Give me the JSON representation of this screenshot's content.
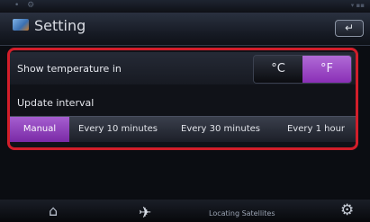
{
  "window": {
    "title": "Setting",
    "back_label": "↵"
  },
  "temperature": {
    "label": "Show temperature in",
    "options": [
      "°C",
      "°F"
    ],
    "selected": "°F"
  },
  "update_interval": {
    "label": "Update interval",
    "options": [
      "Manual",
      "Every 10 minutes",
      "Every 30 minutes",
      "Every 1 hour"
    ],
    "selected": "Manual"
  },
  "status": {
    "satellite_text": "Locating Satellites"
  },
  "icons": {
    "home": "home-icon",
    "satellite": "satellite-icon",
    "settings": "gear-icon",
    "back": "back-arrow-icon"
  },
  "colors": {
    "accent": "#9a4cc8",
    "highlight_border": "#d21e2a"
  }
}
